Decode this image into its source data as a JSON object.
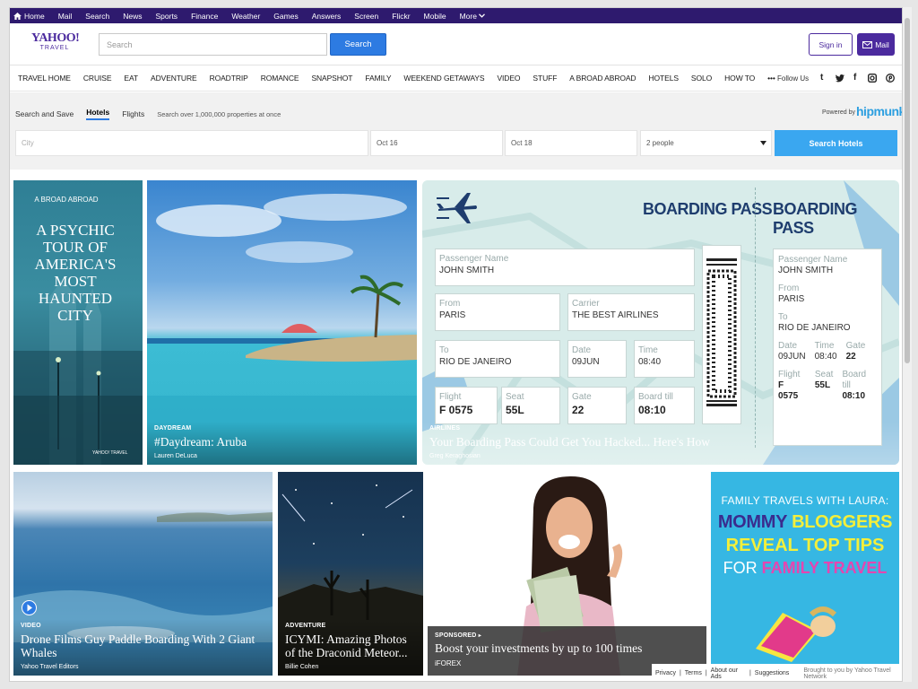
{
  "topnav": {
    "items": [
      "Home",
      "Mail",
      "Search",
      "News",
      "Sports",
      "Finance",
      "Weather",
      "Games",
      "Answers",
      "Screen",
      "Flickr",
      "Mobile",
      "More"
    ]
  },
  "header": {
    "logo_main": "YAHOO!",
    "logo_sub": "TRAVEL",
    "search_placeholder": "Search",
    "search_button": "Search",
    "signin": "Sign in",
    "mail": "Mail"
  },
  "catnav": {
    "items": [
      "TRAVEL HOME",
      "CRUISE",
      "EAT",
      "ADVENTURE",
      "ROADTRIP",
      "ROMANCE",
      "SNAPSHOT",
      "FAMILY",
      "WEEKEND GETAWAYS",
      "VIDEO",
      "STUFF",
      "A BROAD ABROAD",
      "HOTELS",
      "SOLO",
      "HOW TO",
      "•••"
    ],
    "follow_label": "Follow Us",
    "social_icons": [
      "tumblr-icon",
      "twitter-icon",
      "facebook-icon",
      "instagram-icon",
      "pinterest-icon"
    ]
  },
  "hotel": {
    "tabs": [
      "Search and Save",
      "Hotels",
      "Flights"
    ],
    "note": "Search over 1,000,000 properties at once",
    "powered_by": "Powered by",
    "brand": "hipmunk",
    "city_placeholder": "City",
    "checkin": "Oct 16",
    "checkout": "Oct 18",
    "guests": "2 people",
    "button": "Search Hotels"
  },
  "tiles": {
    "haunted": {
      "brand": "A BROAD ABROAD",
      "headline": "A PSYCHIC TOUR OF AMERICA'S MOST HAUNTED CITY",
      "watermark": "YAHOO! TRAVEL"
    },
    "aruba": {
      "category": "DAYDREAM",
      "title": "#Daydream: Aruba",
      "author": "Lauren DeLuca"
    },
    "boarding": {
      "category": "AIRLINES",
      "title": "Your Boarding Pass Could Get You Hacked... Here's How",
      "author": "Greg Keraghosian",
      "pass": {
        "heading": "BOARDING PASS",
        "passenger_label": "Passenger Name",
        "passenger": "JOHN SMITH",
        "from_label": "From",
        "from": "PARIS",
        "carrier_label": "Carrier",
        "carrier": "THE BEST AIRLINES",
        "to_label": "To",
        "to": "RIO DE JANEIRO",
        "date_label": "Date",
        "date": "09JUN",
        "time_label": "Time",
        "time": "08:40",
        "flight_label": "Flight",
        "flight": "F 0575",
        "seat_label": "Seat",
        "seat": "55L",
        "gate_label": "Gate",
        "gate": "22",
        "board_label": "Board till",
        "board": "08:10"
      }
    },
    "whales": {
      "category": "VIDEO",
      "title": "Drone Films Guy Paddle Boarding With 2 Giant Whales",
      "author": "Yahoo Travel Editors"
    },
    "meteor": {
      "category": "ADVENTURE",
      "title": "ICYMI: Amazing Photos of the Draconid Meteor...",
      "author": "Billie Cohen"
    },
    "ad": {
      "category": "SPONSORED",
      "title": "Boost your investments by up to 100 times",
      "author": "iFOREX"
    },
    "family": {
      "line1": "FAMILY TRAVELS WITH LAURA:",
      "line2a": "MOMMY",
      "line2b": "BLOGGERS",
      "line3": "REVEAL TOP TIPS",
      "line4a": "FOR",
      "line4b": "FAMILY TRAVEL"
    }
  },
  "footer": {
    "privacy": "Privacy",
    "terms": "Terms",
    "about_ads": "About our Ads",
    "suggestions": "Suggestions",
    "network": "Brought to you by Yahoo Travel Network"
  },
  "colors": {
    "purple": "#4b2a9e",
    "topbar": "#2e1a6e",
    "blue": "#2d7be2"
  }
}
